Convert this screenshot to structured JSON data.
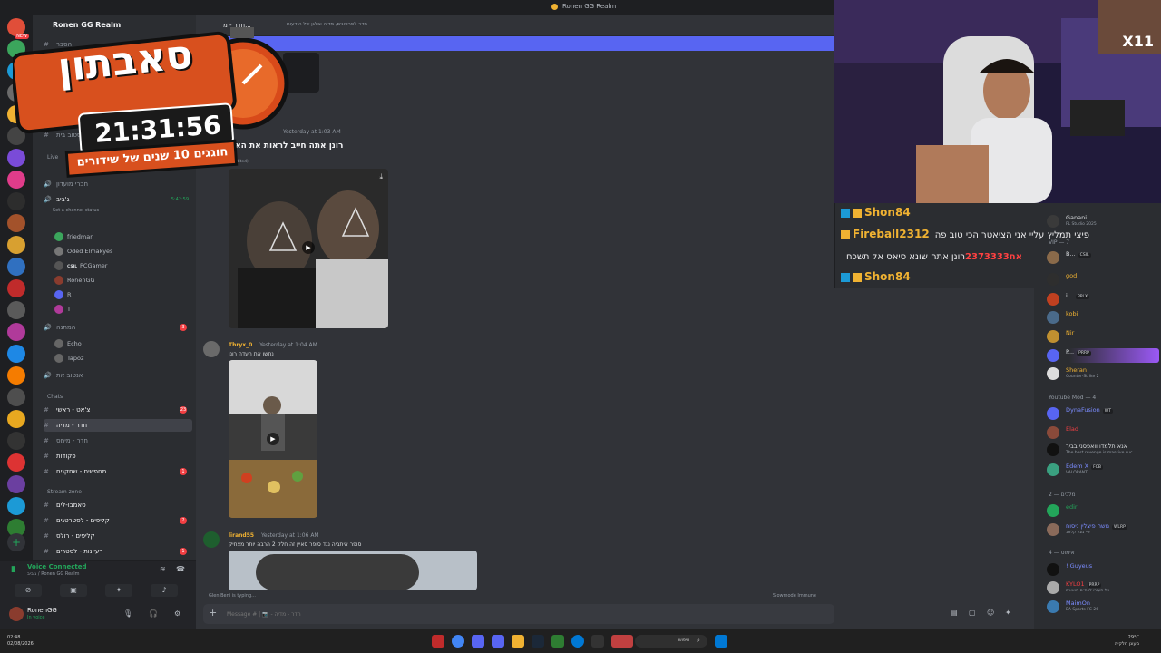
{
  "window": {
    "title": "Ronen GG Realm"
  },
  "server": {
    "name": "Ronen GG Realm"
  },
  "channels": {
    "top_items": [
      {
        "label": "הסבר"
      },
      {
        "label": "שהד ביסטוב בית"
      },
      {
        "label": "חברי מועדון"
      },
      {
        "label": "ג'ביב",
        "timer": "5:42:59"
      }
    ],
    "channel_status": "Set a channel status",
    "voice_users": [
      "friedman",
      "Oded Elmakyes",
      "PCGamer",
      "RonenGG",
      "R",
      "T"
    ],
    "voice_badge": "CSIL",
    "waiting": {
      "label": "המתנה",
      "count": "3"
    },
    "waiting_users": [
      "Echo",
      "Tapoz"
    ],
    "afk": {
      "label": "אנטוב את"
    },
    "live_label": "Live",
    "chats_category": "Chats",
    "chat_channels": [
      {
        "label": "צ'אט - ראשי",
        "count": "23"
      },
      {
        "label": "חדר - מדיה",
        "active": true
      },
      {
        "label": "חדר - מימס"
      },
      {
        "label": "פקודות"
      },
      {
        "label": "מחפשים - שחקנים",
        "count": "1"
      }
    ],
    "stream_category": "Stream zone",
    "stream_channels": [
      {
        "label": "סאמבו-לים"
      },
      {
        "label": "קליפים - לסטרטגים",
        "count": "2"
      },
      {
        "label": "קליפים - רולס"
      },
      {
        "label": "רעיונות - לסטרים",
        "count": "1"
      }
    ]
  },
  "voice_panel": {
    "status": "Voice Connected",
    "subtitle": "ג'ביב / Ronen GG Realm"
  },
  "user_panel": {
    "name": "RonenGG",
    "status": "In voice"
  },
  "chat": {
    "channel_name": "חדר - מ...",
    "topic": "חדר לסרטונים, מדיה ובלגן של הודעות",
    "messages": [
      {
        "time": "Yesterday at 1:03 AM",
        "text": "רונן אתה חייב לראות את האו",
        "label": "(edited)"
      },
      {
        "author": "Thryx_0",
        "author_color": "#f0b232",
        "time": "Yesterday at 1:04 AM",
        "text": "נחשו את העדה רונן"
      },
      {
        "author": "lirand55",
        "author_color": "#f0b232",
        "time": "Yesterday at 1:06 AM",
        "text": "סופר איתביה נגד סופר סאיין זה חלק 2 הרבה יותר מצחיק"
      }
    ],
    "typing": "Glen Beni is typing...",
    "slowmode": "Slowmode Immune",
    "composer_placeholder": "Message # | 📷 - חדר - מדיה"
  },
  "stream_chat": [
    {
      "user": "Shon84",
      "color": "#f0b232",
      "message": ""
    },
    {
      "user": "Fireball2312",
      "color": "#f0b232",
      "message": "פיצי תמליץ עליי אני הציאטר הכי טוב פה"
    },
    {
      "user": "אח2373333",
      "color": "#ff4141",
      "message": "רונן אתה שונא סיאס אל תשכח"
    },
    {
      "user": "Shon84",
      "color": "#f0b232",
      "message": ""
    }
  ],
  "members": {
    "top": [
      {
        "name": "Ganani",
        "sub": "FL Studio 2025",
        "color": "#dbdee1"
      },
      {
        "name": "VIP — 7",
        "header": true
      },
      {
        "name": "B...",
        "tag": "CSIL",
        "color": "#dbdee1"
      },
      {
        "name": "god",
        "color": "#f0b232"
      },
      {
        "name": "i...",
        "tag": "PPLX",
        "color": "#dbdee1"
      },
      {
        "name": "kobi",
        "color": "#f0b232"
      },
      {
        "name": "Nir",
        "color": "#f0b232"
      },
      {
        "name": "P...",
        "tag": "PRRP",
        "color": "#dbdee1"
      },
      {
        "name": "Sheran",
        "sub": "Counter-Strike 2",
        "color": "#f0b232"
      }
    ],
    "mod_header": "Youtube Mod — 4",
    "mods": [
      {
        "name": "DynaFusion",
        "tag": "WT",
        "color": "#7b8cff"
      },
      {
        "name": "Elad",
        "color": "#f23f43"
      },
      {
        "name": "אנא תלמדו וואפסני בביר",
        "sub": "The best revenge is massive suc...",
        "color": "#dbdee1"
      },
      {
        "name": "Edem X",
        "tag": "FCB",
        "sub": "VALORANT",
        "color": "#7b8cff"
      }
    ],
    "group2_header": "מלכים — 2",
    "group2": [
      {
        "name": "edir",
        "color": "#23a55a"
      },
      {
        "name": "משה פיצלין ניסוח",
        "tag": "WLRP",
        "sub": "איי גוגל קלאב",
        "color": "#7b8cff"
      }
    ],
    "group3_header": "אימוס — 4",
    "group3": [
      {
        "name": "! Guyeus",
        "color": "#7b8cff"
      },
      {
        "name": "KYLO1",
        "tag": "PRRP",
        "sub": "אל תעזרו לו חיים תאואים",
        "color": "#f23f43"
      },
      {
        "name": "MaimOn",
        "sub": "EA Sports FC 26",
        "color": "#7b8cff"
      }
    ]
  },
  "subathon": {
    "title": "סאבתון",
    "timer": "21:31:56",
    "subtitle": "חוגגים 10 שנים של שידורים"
  },
  "cam": {
    "logo": "X11"
  },
  "taskbar": {
    "left_time": "02:48",
    "left_date": "02/08/2026",
    "weather": "29°C",
    "weather_sub": "מעונן חלקית",
    "search_placeholder": "חיפוש"
  },
  "colors": {
    "accent": "#5865f2",
    "brand": "#f0b232"
  }
}
